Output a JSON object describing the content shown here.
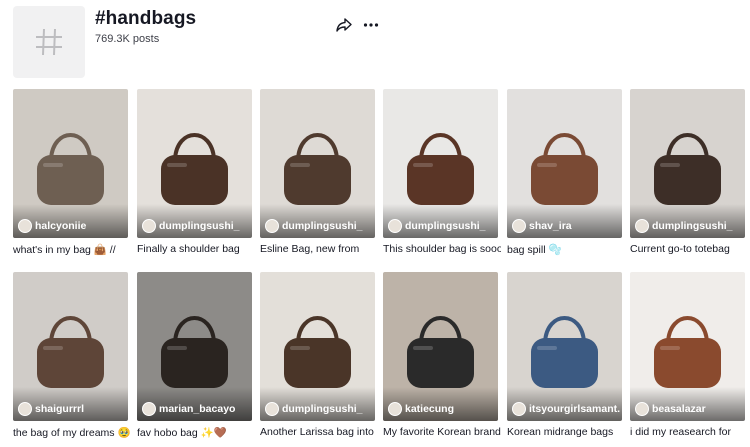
{
  "hashtag": {
    "title": "#handbags",
    "posts": "769.3K posts",
    "thumb_icon": "hashtag-icon",
    "share_icon": "share-arrow-icon",
    "more_icon": "more-dots-icon"
  },
  "posts": [
    {
      "author": "halcyoniie",
      "caption": "what's in my bag 👜 //",
      "bg": "#cfcac3",
      "bag": "#6e5f52"
    },
    {
      "author": "dumplingsushi_",
      "caption": "Finally a shoulder bag",
      "bg": "#e4e0db",
      "bag": "#4a3226"
    },
    {
      "author": "dumplingsushi_",
      "caption": "Esline Bag, new from",
      "bg": "#dedad5",
      "bag": "#4f3a2e"
    },
    {
      "author": "dumplingsushi_",
      "caption": "This shoulder bag is sooo",
      "bg": "#e9e8e6",
      "bag": "#5a3526"
    },
    {
      "author": "shav_ira",
      "caption": "bag spill 🫧",
      "bg": "#e2e0de",
      "bag": "#7a4a34"
    },
    {
      "author": "dumplingsushi_",
      "caption": "Current go-to totebag",
      "bg": "#d7d3cf",
      "bag": "#3d2e27"
    },
    {
      "author": "shaigurrrl",
      "caption": "the bag of my dreams 🥹",
      "bg": "#d0ccc8",
      "bag": "#5e4538"
    },
    {
      "author": "marian_bacayo",
      "caption": "fav hobo bag ✨🤎",
      "bg": "#8d8b88",
      "bag": "#2a2420"
    },
    {
      "author": "dumplingsushi_",
      "caption": "Another Larissa bag into",
      "bg": "#e3dfd9",
      "bag": "#4a3528"
    },
    {
      "author": "katiecung",
      "caption": "My favorite Korean brand",
      "bg": "#bdb3a8",
      "bag": "#2a2a2a"
    },
    {
      "author": "itsyourgirlsamant...",
      "caption": "Korean midrange bags",
      "bg": "#d8d4cf",
      "bag": "#3c5a82"
    },
    {
      "author": "beasalazar",
      "caption": "i did my reasearch for",
      "bg": "#f0edea",
      "bag": "#8a4a2e"
    }
  ]
}
